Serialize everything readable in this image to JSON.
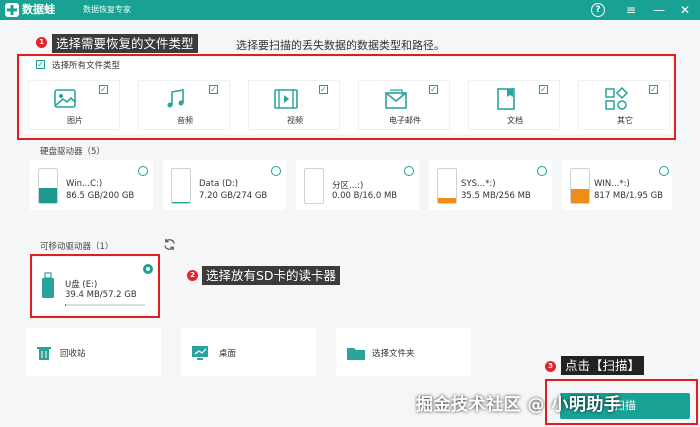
{
  "app": {
    "name": "数据蛙",
    "subtitle": "数据恢复专家"
  },
  "window_controls": {
    "help": "?",
    "menu": "≡",
    "minimize": "—",
    "close": "✕"
  },
  "callouts": {
    "one": {
      "num": "1",
      "text": "选择需要恢复的文件类型"
    },
    "two": {
      "num": "2",
      "text": "选择放有SD卡的读卡器"
    },
    "three": {
      "num": "3",
      "text": "点击【扫描】"
    }
  },
  "instruction": "选择要扫描的丢失数据的数据类型和路径。",
  "select_all_label": "选择所有文件类型",
  "file_types": [
    {
      "label": "图片",
      "icon": "image-icon",
      "checked": true
    },
    {
      "label": "音频",
      "icon": "music-icon",
      "checked": true
    },
    {
      "label": "视频",
      "icon": "video-icon",
      "checked": true
    },
    {
      "label": "电子邮件",
      "icon": "email-icon",
      "checked": true
    },
    {
      "label": "文档",
      "icon": "document-icon",
      "checked": true
    },
    {
      "label": "其它",
      "icon": "other-icon",
      "checked": true
    }
  ],
  "hdd_section": {
    "title": "硬盘驱动器（5）"
  },
  "drives": [
    {
      "name": "Win...C:)",
      "size": "86.5 GB/200 GB",
      "used_fraction": 0.43,
      "color": "#1e9a8c"
    },
    {
      "name": "Data (D:)",
      "size": "7.20 GB/274 GB",
      "used_fraction": 0.03,
      "color": "#1e9a8c"
    },
    {
      "name": "分区...:)",
      "size": "0.00  B/16.0 MB",
      "used_fraction": 0.0,
      "color": "#f08c1a"
    },
    {
      "name": "SYS...*:)",
      "size": "35.5 MB/256 MB",
      "used_fraction": 0.14,
      "color": "#f08c1a"
    },
    {
      "name": "WIN...*:)",
      "size": "817 MB/1.95 GB",
      "used_fraction": 0.42,
      "color": "#f08c1a"
    }
  ],
  "removable_section": {
    "title": "可移动驱动器（1）",
    "refresh_icon": "refresh-icon"
  },
  "removable_drive": {
    "name": "U盘 (E:)",
    "size": "39.4 MB/57.2 GB",
    "used_fraction": 0.001,
    "selected": true
  },
  "locations": [
    {
      "label": "回收站",
      "icon": "recycle-bin-icon"
    },
    {
      "label": "桌面",
      "icon": "desktop-icon"
    },
    {
      "label": "选择文件夹",
      "icon": "folder-icon"
    }
  ],
  "scan_button": {
    "label": "扫描"
  },
  "watermark": "掘金技术社区 @ 小明助手",
  "colors": {
    "brand": "#18a293",
    "callout_red": "#e0262b",
    "orange": "#f08c1a"
  }
}
